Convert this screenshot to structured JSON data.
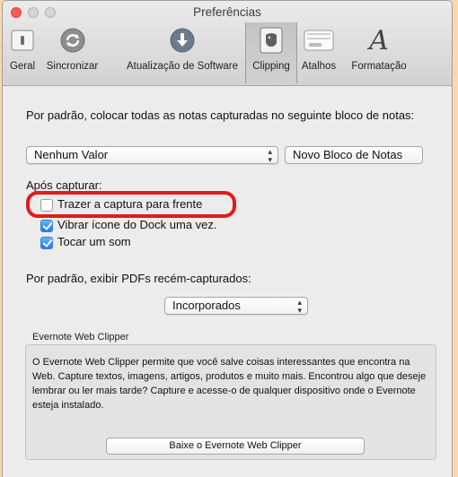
{
  "window": {
    "title": "Preferências"
  },
  "toolbar": {
    "items": [
      {
        "label": "Geral",
        "icon": "switch-icon"
      },
      {
        "label": "Sincronizar",
        "icon": "sync-icon"
      },
      {
        "label": "Atualização de Software",
        "icon": "download-icon"
      },
      {
        "label": "Clipping",
        "icon": "evernote-elephant-icon",
        "selected": true
      },
      {
        "label": "Atalhos",
        "icon": "keyboard-icon"
      },
      {
        "label": "Formatação",
        "icon": "font-icon"
      }
    ]
  },
  "notebook": {
    "prompt": "Por padrão, colocar todas as notas capturadas no seguinte bloco de notas:",
    "selected": "Nenhum Valor",
    "new_button": "Novo Bloco de Notas"
  },
  "after_capture": {
    "heading": "Após capturar:",
    "options": [
      {
        "label": "Trazer a captura para frente",
        "checked": false
      },
      {
        "label": "Vibrar ícone do Dock uma vez.",
        "checked": true
      },
      {
        "label": "Tocar um som",
        "checked": true
      }
    ]
  },
  "pdf": {
    "label": "Por padrão, exibir PDFs recém-capturados:",
    "selected": "Incorporados"
  },
  "web_clipper": {
    "title": "Evernote Web Clipper",
    "description": "O Evernote Web Clipper permite que você salve coisas interessantes que encontra na Web. Capture textos, imagens, artigos, produtos e muito mais. Encontrou algo que deseje lembrar ou ler mais tarde? Capture e acesse-o de qualquer dispositivo onde o Evernote esteja instalado.",
    "button": "Baixe o Evernote Web Clipper"
  },
  "colors": {
    "background": "#fbd7ad",
    "highlight": "#e21b1b",
    "checkbox_checked": "#157efb"
  }
}
